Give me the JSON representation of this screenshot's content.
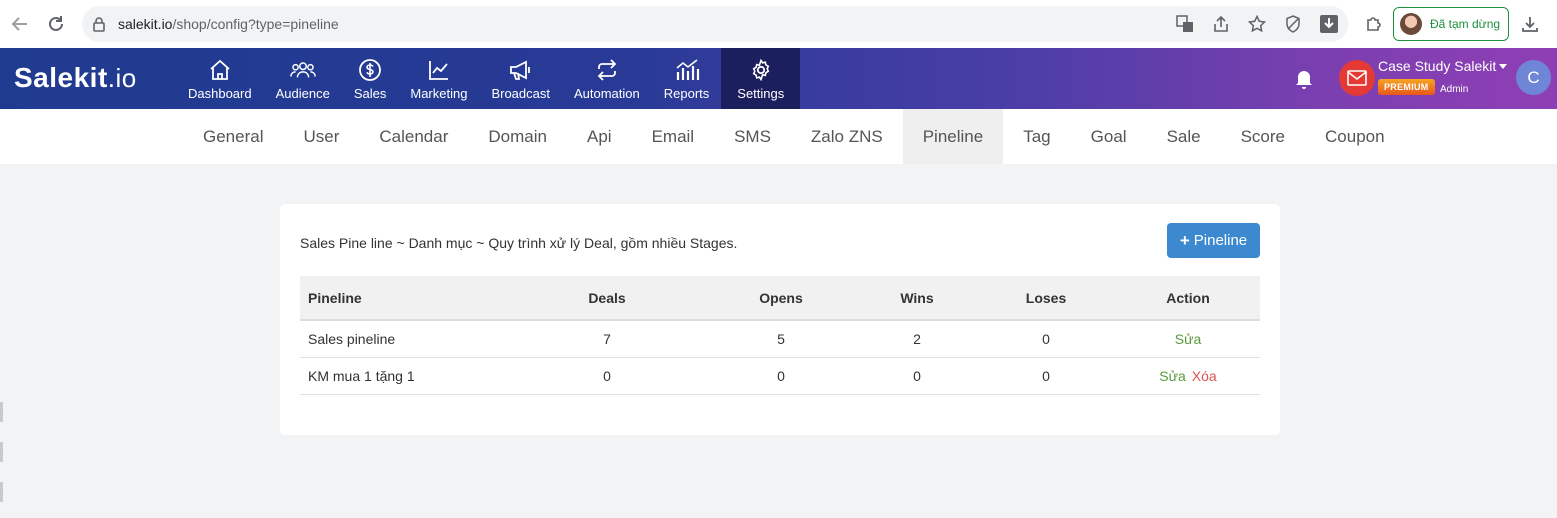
{
  "browser": {
    "url_host": "salekit.io",
    "url_path": "/shop/config?type=pineline",
    "profile_status": "Đã tạm dừng"
  },
  "app": {
    "logo_main": "Salekit",
    "logo_suffix": ".io",
    "nav": [
      {
        "label": "Dashboard",
        "icon": "home-icon"
      },
      {
        "label": "Audience",
        "icon": "users-icon"
      },
      {
        "label": "Sales",
        "icon": "dollar-icon"
      },
      {
        "label": "Marketing",
        "icon": "chart-line-icon"
      },
      {
        "label": "Broadcast",
        "icon": "megaphone-icon"
      },
      {
        "label": "Automation",
        "icon": "repeat-icon"
      },
      {
        "label": "Reports",
        "icon": "bar-chart-icon"
      },
      {
        "label": "Settings",
        "icon": "gear-icon"
      }
    ],
    "active_nav": "Settings",
    "account_name": "Case Study Salekit",
    "plan_badge": "PREMIUM",
    "role": "Admin",
    "avatar_letter": "C"
  },
  "sub_nav": {
    "items": [
      "General",
      "User",
      "Calendar",
      "Domain",
      "Api",
      "Email",
      "SMS",
      "Zalo ZNS",
      "Pineline",
      "Tag",
      "Goal",
      "Sale",
      "Score",
      "Coupon"
    ],
    "active": "Pineline"
  },
  "card": {
    "description": "Sales Pine line ~ Danh mục ~ Quy trình xử lý Deal, gồm nhiều Stages.",
    "add_button": "Pineline",
    "table": {
      "headers": [
        "Pineline",
        "Deals",
        "Opens",
        "Wins",
        "Loses",
        "Action"
      ],
      "rows": [
        {
          "name": "Sales pineline",
          "deals": "7",
          "opens": "5",
          "wins": "2",
          "loses": "0",
          "edit": "Sửa",
          "delete": ""
        },
        {
          "name": "KM mua 1 tặng 1",
          "deals": "0",
          "opens": "0",
          "wins": "0",
          "loses": "0",
          "edit": "Sửa",
          "delete": "Xóa"
        }
      ]
    }
  },
  "colors": {
    "primary_button": "#3c89cf",
    "edit_link": "#5a9a3c",
    "delete_link": "#d9534f",
    "header_start": "#1f3b8f",
    "header_end": "#8f3fb5"
  }
}
